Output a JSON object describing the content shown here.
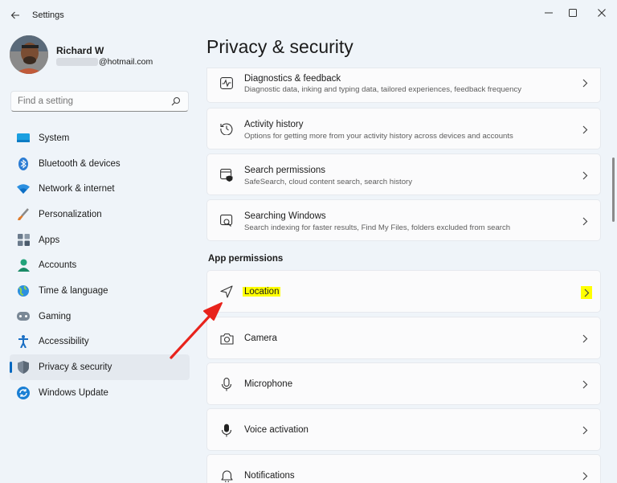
{
  "titlebar": {
    "app_title": "Settings"
  },
  "profile": {
    "name": "Richard W",
    "email_suffix": "@hotmail.com"
  },
  "search": {
    "placeholder": "Find a setting"
  },
  "sidebar": {
    "items": [
      {
        "label": "System",
        "icon": "system-icon"
      },
      {
        "label": "Bluetooth & devices",
        "icon": "bluetooth-icon"
      },
      {
        "label": "Network & internet",
        "icon": "wifi-icon"
      },
      {
        "label": "Personalization",
        "icon": "brush-icon"
      },
      {
        "label": "Apps",
        "icon": "apps-icon"
      },
      {
        "label": "Accounts",
        "icon": "accounts-icon"
      },
      {
        "label": "Time & language",
        "icon": "globe-icon"
      },
      {
        "label": "Gaming",
        "icon": "gamepad-icon"
      },
      {
        "label": "Accessibility",
        "icon": "accessibility-icon"
      },
      {
        "label": "Privacy & security",
        "icon": "shield-icon",
        "active": true
      },
      {
        "label": "Windows Update",
        "icon": "update-icon"
      }
    ]
  },
  "main": {
    "title": "Privacy & security",
    "cards": [
      {
        "title": "Diagnostics & feedback",
        "desc": "Diagnostic data, inking and typing data, tailored experiences, feedback frequency",
        "icon": "diagnostics-icon"
      },
      {
        "title": "Activity history",
        "desc": "Options for getting more from your activity history across devices and accounts",
        "icon": "history-icon"
      },
      {
        "title": "Search permissions",
        "desc": "SafeSearch, cloud content search, search history",
        "icon": "search-permissions-icon"
      },
      {
        "title": "Searching Windows",
        "desc": "Search indexing for faster results, Find My Files, folders excluded from search",
        "icon": "searching-windows-icon"
      }
    ],
    "section_header": "App permissions",
    "permissions": [
      {
        "title": "Location",
        "icon": "location-icon",
        "highlighted": true
      },
      {
        "title": "Camera",
        "icon": "camera-icon"
      },
      {
        "title": "Microphone",
        "icon": "microphone-icon"
      },
      {
        "title": "Voice activation",
        "icon": "voice-activation-icon"
      },
      {
        "title": "Notifications",
        "icon": "notifications-icon"
      }
    ]
  },
  "colors": {
    "accent": "#0067c0",
    "highlight": "#ffff00",
    "annotation_arrow": "#e8231c",
    "window_bg": "#eff4f9",
    "card_bg": "#fbfbfc"
  }
}
